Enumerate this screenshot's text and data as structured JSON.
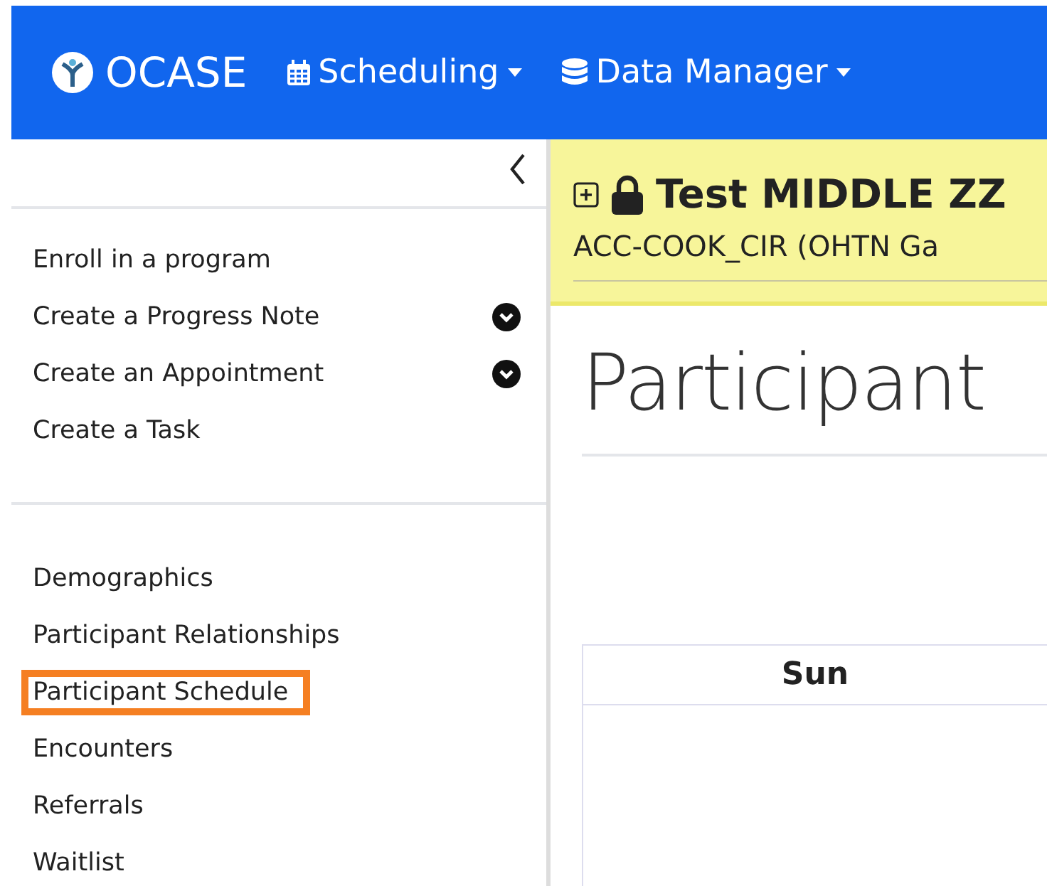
{
  "navbar": {
    "brand": "OCASE",
    "menus": [
      {
        "label": "Scheduling",
        "kind": "calendar"
      },
      {
        "label": "Data Manager",
        "kind": "database"
      }
    ]
  },
  "sidebar": {
    "actions": [
      {
        "label": "Enroll in a program",
        "expandable": false
      },
      {
        "label": "Create a Progress Note",
        "expandable": true
      },
      {
        "label": "Create an Appointment",
        "expandable": true
      },
      {
        "label": "Create a Task",
        "expandable": false
      }
    ],
    "items": [
      {
        "label": "Demographics",
        "selected": false
      },
      {
        "label": "Participant Relationships",
        "selected": false
      },
      {
        "label": "Participant Schedule",
        "selected": true
      },
      {
        "label": "Encounters",
        "selected": false
      },
      {
        "label": "Referrals",
        "selected": false
      },
      {
        "label": "Waitlist",
        "selected": false
      }
    ]
  },
  "banner": {
    "title": "Test MIDDLE ZZ",
    "subtitle": "ACC-COOK_CIR (OHTN Ga"
  },
  "page_title": "Participant",
  "calendar": {
    "columns": [
      "Sun"
    ]
  }
}
